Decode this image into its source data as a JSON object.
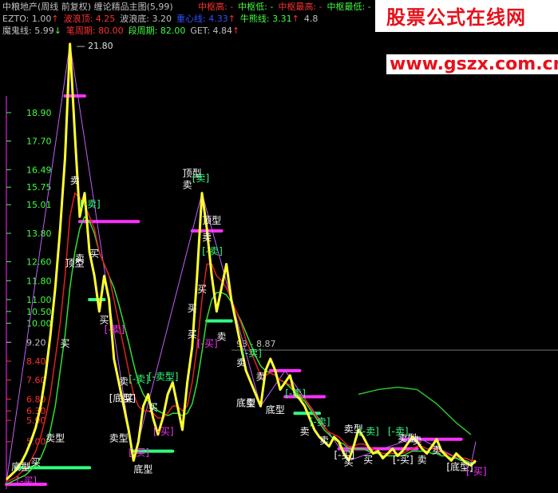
{
  "header": {
    "title": "中粮地产(周线 前复权) 缠论精品主图(5,99)",
    "line1": [
      {
        "label": "中枢高: -",
        "color": "#ff3030"
      },
      {
        "label": "中枢低: -",
        "color": "#40ff40"
      },
      {
        "label": "中枢最高: -",
        "color": "#ff3030"
      },
      {
        "label": "中枢最低: -",
        "color": "#40ff40"
      },
      {
        "label": "中",
        "color": "#ff3030"
      }
    ],
    "line2": [
      {
        "label": "EZTO: 1.00",
        "color": "#c0c0c0",
        "arrow": "↑",
        "arrow_color": "#ff3030"
      },
      {
        "label": "波浪顶: 4.25",
        "color": "#ff3030"
      },
      {
        "label": "波浪底: 3.20",
        "color": "#c0c0c0"
      },
      {
        "label": "重心线: 4.33",
        "color": "#3050ff",
        "arrow": "↑",
        "arrow_color": "#ff3030"
      },
      {
        "label": "牛熊线: 3.31",
        "color": "#40ff40",
        "arrow": "↑",
        "arrow_color": "#ff3030"
      },
      {
        "label": "4.8",
        "color": "#c0c0c0"
      }
    ],
    "line3": [
      {
        "label": "魔鬼线: 5.99",
        "color": "#c0c0c0",
        "arrow": "↓",
        "arrow_color": "#40ff40"
      },
      {
        "label": "笔周期: 80.00",
        "color": "#ff3030"
      },
      {
        "label": "段周期: 82.00",
        "color": "#40ff40"
      },
      {
        "label": "GET: 4.84",
        "color": "#c0c0c0",
        "arrow": "↑",
        "arrow_color": "#ff3030"
      }
    ]
  },
  "watermark": {
    "name": "股票公式在线网",
    "url": "www.gszx.com.cn"
  },
  "chart_data": {
    "type": "line",
    "y_ticks": [
      {
        "v": 18.9,
        "color": "#40ff40"
      },
      {
        "v": 17.7,
        "color": "#40ff40"
      },
      {
        "v": 16.49,
        "color": "#40ff40"
      },
      {
        "v": 15.75,
        "color": "#40ff40"
      },
      {
        "v": 15.01,
        "color": "#40ff40"
      },
      {
        "v": 13.8,
        "color": "#40ff40"
      },
      {
        "v": 12.6,
        "color": "#40ff40"
      },
      {
        "v": 11.8,
        "color": "#40ff40"
      },
      {
        "v": 11.0,
        "color": "#40ff40"
      },
      {
        "v": 10.5,
        "color": "#40ff40"
      },
      {
        "v": 10.0,
        "color": "#40ff40"
      },
      {
        "v": 9.2,
        "color": "#c0c0c0"
      },
      {
        "v": 8.4,
        "color": "#ff3030"
      },
      {
        "v": 7.6,
        "color": "#ff3030"
      },
      {
        "v": 6.8,
        "color": "#ff3030"
      },
      {
        "v": 6.3,
        "color": "#ff3030"
      },
      {
        "v": 5.9,
        "color": "#ff3030"
      },
      {
        "v": 5.0,
        "color": "#ff3030"
      }
    ],
    "peak_label": "21.80",
    "range_label": "93 - 8.87",
    "ref_price": 8.87,
    "ylim": [
      3.0,
      21.8
    ],
    "price": [
      3.4,
      3.6,
      3.8,
      4.1,
      4.5,
      5.0,
      5.6,
      6.5,
      7.8,
      9.5,
      11.5,
      14,
      17,
      21.8,
      18,
      14.5,
      15.5,
      13,
      12,
      10.5,
      12,
      11,
      8.5,
      7.5,
      6.5,
      5.5,
      4.2,
      5,
      6.5,
      7,
      6,
      5.3,
      6,
      7,
      7.5,
      6.5,
      5.5,
      7.5,
      9,
      12,
      15.5,
      14,
      12,
      10.5,
      11.5,
      12.5,
      11,
      10,
      9,
      8,
      7.5,
      7,
      6.5,
      8,
      8.5,
      8,
      7.2,
      7.5,
      7.8,
      7,
      6.8,
      6.5,
      6,
      5.5,
      5.2,
      5,
      4.8,
      5.2,
      5,
      4.5,
      4.2,
      4.8,
      5.5,
      5.2,
      4.8,
      4.5,
      4.6,
      4.3,
      4.5,
      4.7,
      4.4,
      4.6,
      4.9,
      5.2,
      5.0,
      4.7,
      4.5,
      4.8,
      5.1,
      4.6,
      4.4,
      4.2,
      4.5,
      4.3,
      4.1,
      4.0,
      4.2
    ],
    "ma_red": [
      3.3,
      3.4,
      3.5,
      3.7,
      3.9,
      4.2,
      4.6,
      5.2,
      6,
      7,
      8.5,
      10,
      12,
      14.5,
      15.5,
      15.3,
      15,
      14.5,
      14,
      13,
      12.5,
      12,
      11,
      10,
      9,
      8,
      7,
      6.5,
      6.3,
      6.3,
      6.2,
      6,
      6,
      6.2,
      6.5,
      6.5,
      6.3,
      6.5,
      7.5,
      9,
      11,
      12.5,
      12.5,
      12,
      11.8,
      11.5,
      11,
      10.5,
      10,
      9.3,
      8.8,
      8.3,
      7.8,
      7.8,
      7.9,
      7.8,
      7.6,
      7.5,
      7.4,
      7.2,
      7,
      6.8,
      6.5,
      6.2,
      5.9,
      5.6,
      5.4,
      5.3,
      5.2,
      5,
      4.8,
      4.8,
      4.9,
      4.9,
      4.8,
      4.7,
      4.6,
      4.5,
      4.5,
      4.5,
      4.5,
      4.5,
      4.6,
      4.7,
      4.8,
      4.8,
      4.7,
      4.7,
      4.7,
      4.6,
      4.5,
      4.4,
      4.4,
      4.3,
      4.3,
      4.2,
      4.2
    ],
    "ma_green": [
      3.2,
      3.3,
      3.4,
      3.5,
      3.6,
      3.8,
      4,
      4.3,
      4.8,
      5.5,
      6.5,
      8,
      9.5,
      11.5,
      13,
      14,
      14.5,
      14.3,
      13.8,
      13,
      12.5,
      12,
      11.5,
      10.8,
      10,
      9.2,
      8.3,
      7.5,
      7,
      6.7,
      6.5,
      6.3,
      6.2,
      6.1,
      6.2,
      6.2,
      6.1,
      6.2,
      6.6,
      7.5,
      8.8,
      10.2,
      11,
      11.3,
      11.3,
      11.2,
      10.9,
      10.5,
      10.1,
      9.6,
      9.1,
      8.6,
      8.2,
      8,
      7.9,
      7.8,
      7.6,
      7.5,
      7.3,
      7.1,
      6.9,
      6.7,
      6.4,
      6.1,
      5.8,
      5.5,
      5.3,
      5.1,
      5,
      4.9,
      4.7,
      4.7,
      4.7,
      4.7,
      4.6,
      4.5,
      4.5,
      4.4,
      4.4,
      4.4,
      4.4,
      4.4,
      4.5,
      4.6,
      4.6,
      4.6,
      4.6,
      4.5,
      4.5,
      4.4,
      4.4,
      4.3,
      4.3,
      4.2,
      4.2,
      4.1,
      4.1
    ],
    "zigzag": [
      [
        0,
        3.3
      ],
      [
        13,
        21.8
      ],
      [
        26,
        4.2
      ],
      [
        40,
        15.5
      ],
      [
        52,
        6.5
      ],
      [
        57,
        8.0
      ],
      [
        70,
        4.2
      ],
      [
        84,
        5.2
      ],
      [
        95,
        4.0
      ],
      [
        96,
        5.0
      ]
    ],
    "bands": [
      {
        "x0": 12,
        "x1": 16,
        "y": 19.6,
        "color": "#ff30ff"
      },
      {
        "x0": 15,
        "x1": 27,
        "y": 14.3,
        "color": "#ff30ff"
      },
      {
        "x0": 17,
        "x1": 20,
        "y": 11.0,
        "color": "#30ff80"
      },
      {
        "x0": 38,
        "x1": 44,
        "y": 13.9,
        "color": "#ff30ff"
      },
      {
        "x0": 41,
        "x1": 46,
        "y": 10.1,
        "color": "#30ff80"
      },
      {
        "x0": 54,
        "x1": 60,
        "y": 8.0,
        "color": "#ff30ff"
      },
      {
        "x0": 57,
        "x1": 65,
        "y": 6.9,
        "color": "#ff30ff"
      },
      {
        "x0": 59,
        "x1": 64,
        "y": 6.2,
        "color": "#30ff80"
      },
      {
        "x0": 26,
        "x1": 34,
        "y": 4.6,
        "color": "#30ff80"
      },
      {
        "x0": 2,
        "x1": 17,
        "y": 3.9,
        "color": "#30ff80"
      },
      {
        "x0": 0,
        "x1": 8,
        "y": 3.2,
        "color": "#ff30ff"
      },
      {
        "x0": 68,
        "x1": 84,
        "y": 4.7,
        "color": "#ff30ff"
      },
      {
        "x0": 81,
        "x1": 93,
        "y": 5.1,
        "color": "#ff30ff"
      }
    ],
    "green_curve": [
      [
        72,
        7.0
      ],
      [
        76,
        7.2
      ],
      [
        80,
        7.3
      ],
      [
        84,
        7.2
      ],
      [
        88,
        6.6
      ],
      [
        92,
        5.8
      ],
      [
        95,
        5.3
      ]
    ],
    "signals": [
      {
        "i": 14,
        "y": 15.9,
        "t": "卖",
        "c": "#ffffff"
      },
      {
        "i": 16,
        "y": 14.9,
        "t": "[-卖]",
        "c": "#30ff80"
      },
      {
        "i": 15,
        "y": 12.6,
        "t": "卖",
        "c": "#ffffff"
      },
      {
        "i": 18,
        "y": 12.8,
        "t": "买",
        "c": "#ffffff"
      },
      {
        "i": 13,
        "y": 12.4,
        "t": "顶型",
        "c": "#ffffff"
      },
      {
        "i": 12,
        "y": 9.0,
        "t": "买",
        "c": "#ffffff"
      },
      {
        "i": 20,
        "y": 10.0,
        "t": "买",
        "c": "#ffffff"
      },
      {
        "i": 21,
        "y": 9.6,
        "t": "[-卖]",
        "c": "#ff30ff"
      },
      {
        "i": 24,
        "y": 7.4,
        "t": "卖",
        "c": "#ffffff"
      },
      {
        "i": 26,
        "y": 7.5,
        "t": "[-卖]",
        "c": "#30ff80"
      },
      {
        "i": 22,
        "y": 6.7,
        "t": "[底型]",
        "c": "#ffffff"
      },
      {
        "i": 25,
        "y": 6.7,
        "t": "买",
        "c": "#ffffff"
      },
      {
        "i": 30,
        "y": 7.6,
        "t": "[-卖型]",
        "c": "#30ff80"
      },
      {
        "i": 30,
        "y": 6.3,
        "t": "买",
        "c": "#ffffff"
      },
      {
        "i": 31,
        "y": 5.3,
        "t": "[-买]",
        "c": "#ff30ff"
      },
      {
        "i": 22,
        "y": 5.0,
        "t": "卖型",
        "c": "#ffffff"
      },
      {
        "i": 26,
        "y": 4.4,
        "t": "[-买]",
        "c": "#ff30ff"
      },
      {
        "i": 27,
        "y": 3.7,
        "t": "底型",
        "c": "#ffffff"
      },
      {
        "i": 9,
        "y": 5.0,
        "t": "卖型",
        "c": "#ffffff"
      },
      {
        "i": 6,
        "y": 4.0,
        "t": "买",
        "c": "#ffffff"
      },
      {
        "i": 2,
        "y": 3.8,
        "t": "底型",
        "c": "#ffffff"
      },
      {
        "i": 3,
        "y": 3.2,
        "t": "[-买]",
        "c": "#ff30ff"
      },
      {
        "i": 37,
        "y": 16.2,
        "t": "顶型",
        "c": "#ffffff"
      },
      {
        "i": 39,
        "y": 16.0,
        "t": "[卖]",
        "c": "#30ff80"
      },
      {
        "i": 37,
        "y": 15.7,
        "t": "卖",
        "c": "#ffffff"
      },
      {
        "i": 41,
        "y": 14.2,
        "t": "顶型",
        "c": "#ffffff"
      },
      {
        "i": 41,
        "y": 13.5,
        "t": "卖",
        "c": "#ffffff"
      },
      {
        "i": 41,
        "y": 12.9,
        "t": "[-卖]",
        "c": "#30ff80"
      },
      {
        "i": 40,
        "y": 11.3,
        "t": "买",
        "c": "#ffffff"
      },
      {
        "i": 38,
        "y": 10.5,
        "t": "买",
        "c": "#ffffff"
      },
      {
        "i": 38,
        "y": 9.4,
        "t": "买",
        "c": "#ffffff"
      },
      {
        "i": 40,
        "y": 9.0,
        "t": "[-买]",
        "c": "#ff30ff"
      },
      {
        "i": 44,
        "y": 9.3,
        "t": "卖",
        "c": "#ffffff"
      },
      {
        "i": 49,
        "y": 8.6,
        "t": "[-卖]",
        "c": "#30ff80"
      },
      {
        "i": 48,
        "y": 8.2,
        "t": "卖",
        "c": "#ffffff"
      },
      {
        "i": 52,
        "y": 7.6,
        "t": "卖",
        "c": "#ffffff"
      },
      {
        "i": 48,
        "y": 6.5,
        "t": "底型",
        "c": "#ffffff"
      },
      {
        "i": 50,
        "y": 6.5,
        "t": "卖",
        "c": "#ffffff"
      },
      {
        "i": 58,
        "y": 6.9,
        "t": "[-卖]",
        "c": "#30ff80"
      },
      {
        "i": 54,
        "y": 6.2,
        "t": "底型",
        "c": "#ffffff"
      },
      {
        "i": 63,
        "y": 5.7,
        "t": "[-卖]",
        "c": "#30ff80"
      },
      {
        "i": 61,
        "y": 5.3,
        "t": "卖",
        "c": "#ffffff"
      },
      {
        "i": 65,
        "y": 4.9,
        "t": "卖",
        "c": "#ffffff"
      },
      {
        "i": 70,
        "y": 5.4,
        "t": "卖型",
        "c": "#ffffff"
      },
      {
        "i": 73,
        "y": 5.3,
        "t": "[-卖]",
        "c": "#30ff80"
      },
      {
        "i": 68,
        "y": 4.3,
        "t": "[-买]",
        "c": "#ffffff"
      },
      {
        "i": 70,
        "y": 4.0,
        "t": "买",
        "c": "#ffffff"
      },
      {
        "i": 74,
        "y": 4.1,
        "t": "买",
        "c": "#ffffff"
      },
      {
        "i": 79,
        "y": 5.3,
        "t": "[-卖]",
        "c": "#30ff80"
      },
      {
        "i": 81,
        "y": 5.0,
        "t": "卖型",
        "c": "#ffffff"
      },
      {
        "i": 84,
        "y": 4.9,
        "t": "卖",
        "c": "#ffffff"
      },
      {
        "i": 80,
        "y": 4.1,
        "t": "[-买]",
        "c": "#ffffff"
      },
      {
        "i": 85,
        "y": 4.1,
        "t": "卖",
        "c": "#ffffff"
      },
      {
        "i": 88,
        "y": 4.5,
        "t": "卖",
        "c": "#ffffff"
      },
      {
        "i": 91,
        "y": 3.8,
        "t": "[底型]",
        "c": "#ffffff"
      },
      {
        "i": 95,
        "y": 3.6,
        "t": "[-买]",
        "c": "#ff30ff"
      }
    ]
  }
}
